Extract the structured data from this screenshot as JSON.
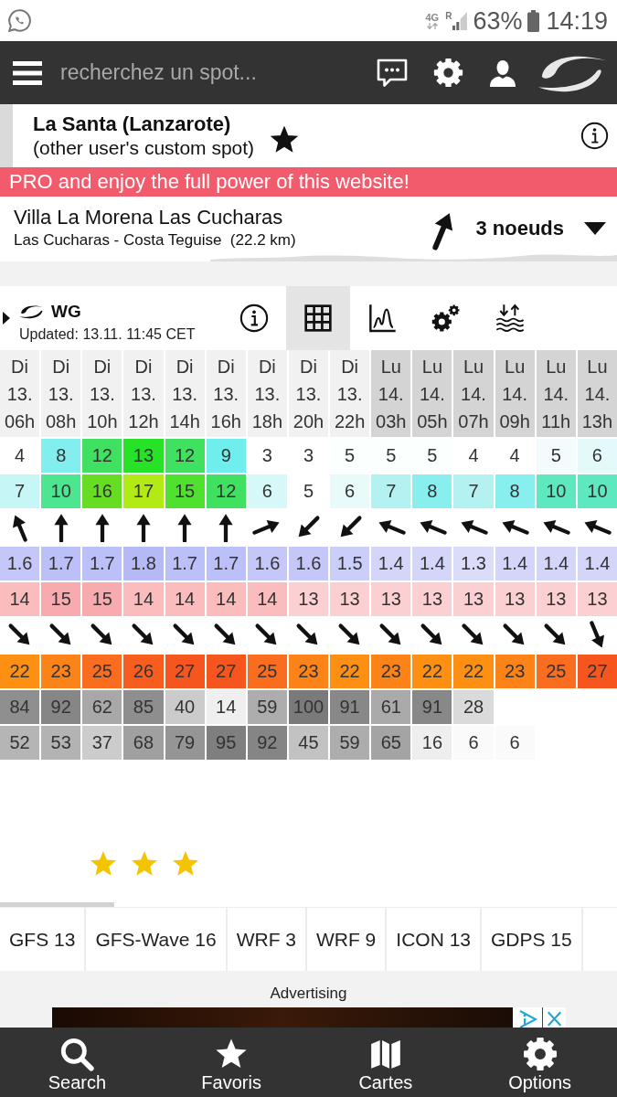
{
  "status_bar": {
    "network": "4G",
    "roaming": "R",
    "battery": "63%",
    "time": "14:19"
  },
  "header": {
    "search": {
      "placeholder": "recherchez un spot..."
    }
  },
  "spot": {
    "name": "La Santa (Lanzarote)",
    "subtitle": "(other user's custom spot)",
    "favorite": true
  },
  "promo_banner": {
    "text": "PRO and enjoy the full power of this website!"
  },
  "station": {
    "name": "Villa La Morena Las Cucharas",
    "location": "Las Cucharas - Costa Teguise  (22.2 km)",
    "wind_arrow": {
      "kind": "nne"
    },
    "wind_speed": "3 noeuds"
  },
  "forecast": {
    "model": "WG",
    "updated": "Updated: 13.11. 11:45 CET",
    "views": [
      {
        "kind": "info",
        "selected": false
      },
      {
        "kind": "table",
        "selected": true
      },
      {
        "kind": "graph",
        "selected": false
      },
      {
        "kind": "settings",
        "selected": false
      },
      {
        "kind": "tides",
        "selected": false
      }
    ],
    "columns": [
      {
        "day": "Di",
        "date": "13.",
        "hour": "06h",
        "color": "#f1f1f1"
      },
      {
        "day": "Di",
        "date": "13.",
        "hour": "08h",
        "color": "#f1f1f1"
      },
      {
        "day": "Di",
        "date": "13.",
        "hour": "10h",
        "color": "#f1f1f1"
      },
      {
        "day": "Di",
        "date": "13.",
        "hour": "12h",
        "color": "#f1f1f1"
      },
      {
        "day": "Di",
        "date": "13.",
        "hour": "14h",
        "color": "#f1f1f1"
      },
      {
        "day": "Di",
        "date": "13.",
        "hour": "16h",
        "color": "#f1f1f1"
      },
      {
        "day": "Di",
        "date": "13.",
        "hour": "18h",
        "color": "#f1f1f1"
      },
      {
        "day": "Di",
        "date": "13.",
        "hour": "20h",
        "color": "#f1f1f1"
      },
      {
        "day": "Di",
        "date": "13.",
        "hour": "22h",
        "color": "#f1f1f1"
      },
      {
        "day": "Lu",
        "date": "14.",
        "hour": "03h",
        "color": "#d4d4d4"
      },
      {
        "day": "Lu",
        "date": "14.",
        "hour": "05h",
        "color": "#d4d4d4"
      },
      {
        "day": "Lu",
        "date": "14.",
        "hour": "07h",
        "color": "#d4d4d4"
      },
      {
        "day": "Lu",
        "date": "14.",
        "hour": "09h",
        "color": "#d4d4d4"
      },
      {
        "day": "Lu",
        "date": "14.",
        "hour": "11h",
        "color": "#d4d4d4"
      },
      {
        "day": "Lu",
        "date": "14.",
        "hour": "13h",
        "color": "#d4d4d4"
      }
    ],
    "rows": [
      {
        "kind": "values",
        "cells": [
          {
            "value": "4",
            "color": "#ffffff"
          },
          {
            "value": "8",
            "color": "#82eeee"
          },
          {
            "value": "12",
            "color": "#40e060"
          },
          {
            "value": "13",
            "color": "#27e327"
          },
          {
            "value": "12",
            "color": "#40e060"
          },
          {
            "value": "9",
            "color": "#70eeee"
          },
          {
            "value": "3",
            "color": "#ffffff"
          },
          {
            "value": "3",
            "color": "#ffffff"
          },
          {
            "value": "5",
            "color": "#fbfffe"
          },
          {
            "value": "5",
            "color": "#fbfffe"
          },
          {
            "value": "5",
            "color": "#fbfffe"
          },
          {
            "value": "4",
            "color": "#ffffff"
          },
          {
            "value": "4",
            "color": "#ffffff"
          },
          {
            "value": "5",
            "color": "#f2fcfc"
          },
          {
            "value": "6",
            "color": "#e4fafa"
          }
        ]
      },
      {
        "kind": "values",
        "cells": [
          {
            "value": "7",
            "color": "#c6f6f6"
          },
          {
            "value": "10",
            "color": "#4de690"
          },
          {
            "value": "16",
            "color": "#66dd22"
          },
          {
            "value": "17",
            "color": "#b2ea14"
          },
          {
            "value": "15",
            "color": "#50e030"
          },
          {
            "value": "12",
            "color": "#40e060"
          },
          {
            "value": "6",
            "color": "#d6f8f8"
          },
          {
            "value": "5",
            "color": "#ffffff"
          },
          {
            "value": "6",
            "color": "#e8fafa"
          },
          {
            "value": "7",
            "color": "#b4f2f2"
          },
          {
            "value": "8",
            "color": "#88eeee"
          },
          {
            "value": "7",
            "color": "#b4f2f2"
          },
          {
            "value": "8",
            "color": "#88eeee"
          },
          {
            "value": "10",
            "color": "#5ee8c0"
          },
          {
            "value": "10",
            "color": "#5ee8c0"
          }
        ]
      },
      {
        "kind": "arrows",
        "cells": [
          {
            "kind": "nnw"
          },
          {
            "kind": "n"
          },
          {
            "kind": "n"
          },
          {
            "kind": "n"
          },
          {
            "kind": "n"
          },
          {
            "kind": "n"
          },
          {
            "kind": "ene"
          },
          {
            "kind": "sw"
          },
          {
            "kind": "sw"
          },
          {
            "kind": "wnw"
          },
          {
            "kind": "wnw"
          },
          {
            "kind": "wnw"
          },
          {
            "kind": "wnw"
          },
          {
            "kind": "wnw"
          },
          {
            "kind": "wnw"
          }
        ]
      },
      {
        "kind": "values",
        "cells": [
          {
            "value": "1.6",
            "color": "#c4c7f8"
          },
          {
            "value": "1.7",
            "color": "#bcc0f8"
          },
          {
            "value": "1.7",
            "color": "#bcc0f8"
          },
          {
            "value": "1.8",
            "color": "#b5baf7"
          },
          {
            "value": "1.7",
            "color": "#bcc0f8"
          },
          {
            "value": "1.7",
            "color": "#bcc0f8"
          },
          {
            "value": "1.6",
            "color": "#c4c7f8"
          },
          {
            "value": "1.6",
            "color": "#c4c7f8"
          },
          {
            "value": "1.5",
            "color": "#cbcef8"
          },
          {
            "value": "1.4",
            "color": "#d3d5f9"
          },
          {
            "value": "1.4",
            "color": "#d3d5f9"
          },
          {
            "value": "1.3",
            "color": "#dadcf9"
          },
          {
            "value": "1.4",
            "color": "#d3d5f9"
          },
          {
            "value": "1.4",
            "color": "#d3d5f9"
          },
          {
            "value": "1.4",
            "color": "#d3d5f9"
          }
        ]
      },
      {
        "kind": "values",
        "cells": [
          {
            "value": "14",
            "color": "#fbbcbe"
          },
          {
            "value": "15",
            "color": "#f8abae"
          },
          {
            "value": "15",
            "color": "#f8abae"
          },
          {
            "value": "14",
            "color": "#fbbcbe"
          },
          {
            "value": "14",
            "color": "#fbbcbe"
          },
          {
            "value": "14",
            "color": "#fbbcbe"
          },
          {
            "value": "14",
            "color": "#fbbcbe"
          },
          {
            "value": "13",
            "color": "#fcd0d2"
          },
          {
            "value": "13",
            "color": "#fcd0d2"
          },
          {
            "value": "13",
            "color": "#fcd0d2"
          },
          {
            "value": "13",
            "color": "#fcd0d2"
          },
          {
            "value": "13",
            "color": "#fcd0d2"
          },
          {
            "value": "13",
            "color": "#fcd0d2"
          },
          {
            "value": "13",
            "color": "#fcd0d2"
          },
          {
            "value": "13",
            "color": "#fcd0d2"
          }
        ]
      },
      {
        "kind": "arrows",
        "cells": [
          {
            "kind": "se"
          },
          {
            "kind": "se"
          },
          {
            "kind": "se"
          },
          {
            "kind": "se"
          },
          {
            "kind": "se"
          },
          {
            "kind": "se"
          },
          {
            "kind": "se"
          },
          {
            "kind": "se"
          },
          {
            "kind": "se"
          },
          {
            "kind": "se"
          },
          {
            "kind": "se"
          },
          {
            "kind": "se"
          },
          {
            "kind": "se"
          },
          {
            "kind": "se"
          },
          {
            "kind": "sse"
          }
        ]
      },
      {
        "kind": "values",
        "cells": [
          {
            "value": "22",
            "color": "#fd9012"
          },
          {
            "value": "23",
            "color": "#fc8318"
          },
          {
            "value": "25",
            "color": "#fa6d1f"
          },
          {
            "value": "26",
            "color": "#f85d20"
          },
          {
            "value": "27",
            "color": "#f6561e"
          },
          {
            "value": "27",
            "color": "#f6561e"
          },
          {
            "value": "25",
            "color": "#fa6d1f"
          },
          {
            "value": "23",
            "color": "#fc8318"
          },
          {
            "value": "22",
            "color": "#fd9012"
          },
          {
            "value": "23",
            "color": "#fc8318"
          },
          {
            "value": "22",
            "color": "#fd9012"
          },
          {
            "value": "22",
            "color": "#fd9012"
          },
          {
            "value": "23",
            "color": "#fc8318"
          },
          {
            "value": "25",
            "color": "#fa6d1f"
          },
          {
            "value": "27",
            "color": "#f6561e"
          }
        ]
      },
      {
        "kind": "values",
        "cells": [
          {
            "value": "84",
            "color": "#8f8f8f"
          },
          {
            "value": "92",
            "color": "#868686"
          },
          {
            "value": "62",
            "color": "#a8a8a8"
          },
          {
            "value": "85",
            "color": "#8e8e8e"
          },
          {
            "value": "40",
            "color": "#cbcbcb"
          },
          {
            "value": "14",
            "color": "#efefef"
          },
          {
            "value": "59",
            "color": "#adadad"
          },
          {
            "value": "100",
            "color": "#7a7a7a"
          },
          {
            "value": "91",
            "color": "#888888"
          },
          {
            "value": "61",
            "color": "#aaaaaa"
          },
          {
            "value": "91",
            "color": "#888888"
          },
          {
            "value": "28",
            "color": "#dadada"
          }
        ]
      },
      {
        "kind": "values",
        "cells": [
          {
            "value": "52",
            "color": "#b5b5b5"
          },
          {
            "value": "53",
            "color": "#b3b3b3"
          },
          {
            "value": "37",
            "color": "#cccccc"
          },
          {
            "value": "68",
            "color": "#a0a0a0"
          },
          {
            "value": "79",
            "color": "#959595"
          },
          {
            "value": "95",
            "color": "#7f7f7f"
          },
          {
            "value": "92",
            "color": "#858585"
          },
          {
            "value": "45",
            "color": "#c2c2c2"
          },
          {
            "value": "59",
            "color": "#adadad"
          },
          {
            "value": "65",
            "color": "#a4a4a4"
          },
          {
            "value": "16",
            "color": "#eeeeee"
          },
          {
            "value": "6",
            "color": "#fafafa"
          },
          {
            "value": "6",
            "color": "#fafafa"
          }
        ]
      }
    ],
    "rating": {
      "stars": 3
    }
  },
  "model_tabs": [
    "GFS 13",
    "GFS-Wave 16",
    "WRF 3",
    "WRF 9",
    "ICON 13",
    "GDPS 15"
  ],
  "advertising": {
    "label": "Advertising"
  },
  "bottom_nav": [
    {
      "kind": "search",
      "label": "Search"
    },
    {
      "kind": "favorites",
      "label": "Favoris"
    },
    {
      "kind": "maps",
      "label": "Cartes"
    },
    {
      "kind": "options",
      "label": "Options"
    }
  ]
}
